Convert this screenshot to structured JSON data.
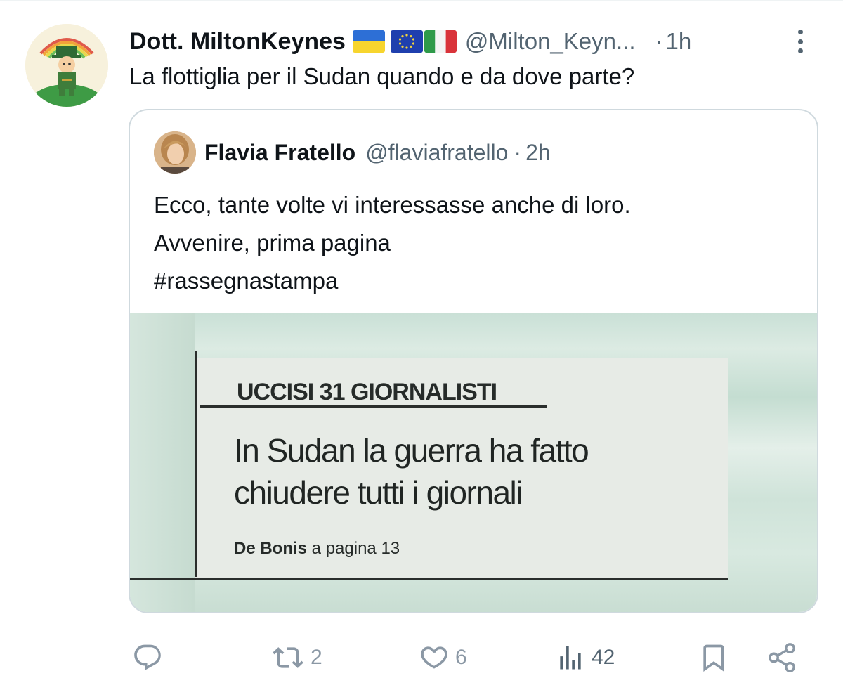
{
  "tweet": {
    "display_name": "Dott. MiltonKeynes",
    "handle": "@Milton_Keyn...",
    "separator": "·",
    "time": "1h",
    "text": "La flottiglia per il Sudan quando e da dove parte?",
    "flags": [
      "ukraine-flag",
      "eu-flag",
      "italy-flag"
    ]
  },
  "quote": {
    "display_name": "Flavia Fratello",
    "handle": "@flaviafratello",
    "separator": "·",
    "time": "2h",
    "text_lines": [
      "Ecco, tante volte vi interessasse anche di loro.",
      "Avvenire, prima pagina",
      "#rassegnastampa"
    ],
    "media": {
      "kicker": "UCCISI 31 GIORNALISTI",
      "headline_lines": [
        "In Sudan la guerra ha fatto",
        "chiudere tutti i giornali"
      ],
      "byline_author": "De Bonis",
      "byline_rest": " a pagina 13"
    }
  },
  "actions": {
    "reply_count": "",
    "retweet_count": "2",
    "like_count": "6",
    "views_count": "42"
  },
  "colors": {
    "text": "#0f1419",
    "secondary": "#536471",
    "icon_muted": "#8b98a5",
    "border": "#cfd9de"
  }
}
